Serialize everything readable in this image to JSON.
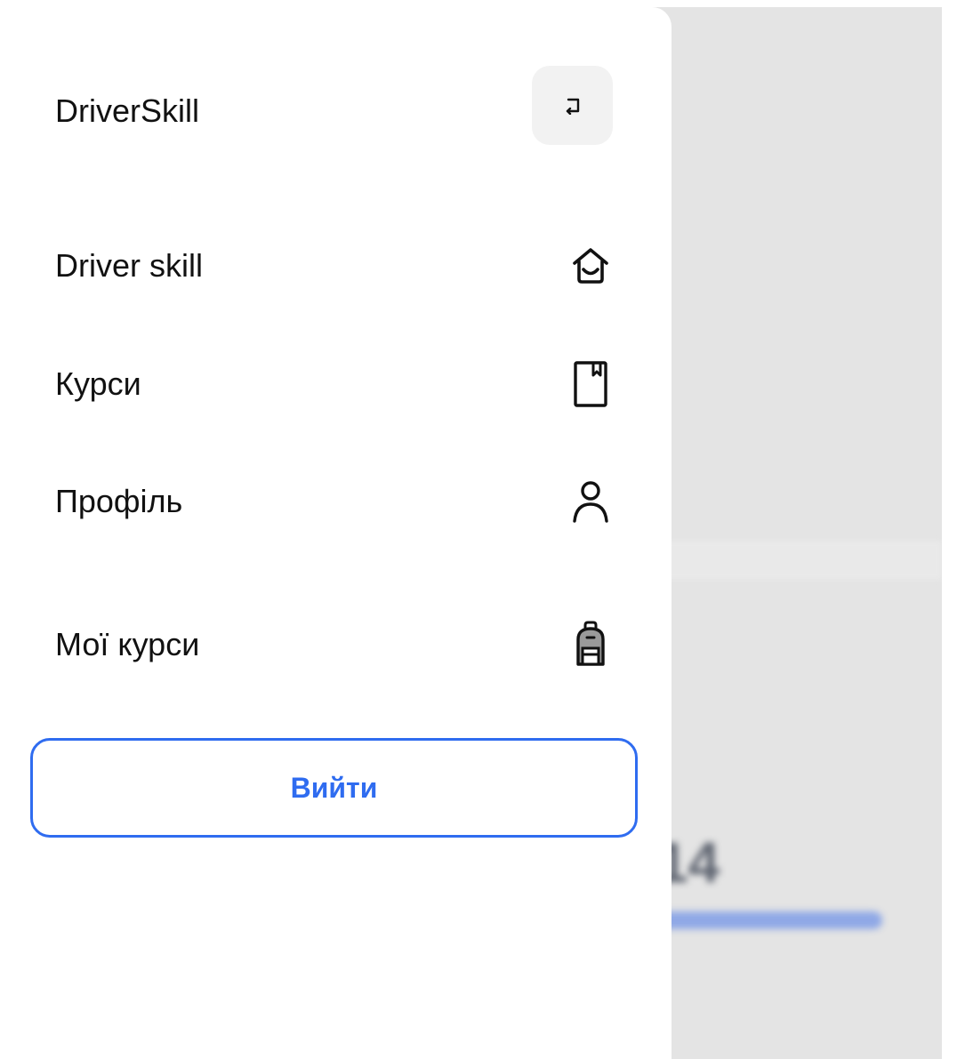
{
  "drawer": {
    "app_title": "DriverSkill",
    "back_icon": "back-arrow-icon",
    "items": [
      {
        "label": "Driver skill",
        "icon": "home-icon"
      },
      {
        "label": "Курси",
        "icon": "book-icon"
      },
      {
        "label": "Профіль",
        "icon": "user-icon"
      },
      {
        "label": "Мої курси",
        "icon": "backpack-icon"
      }
    ],
    "logout_label": "Вийти"
  },
  "backdrop": {
    "small_label": "",
    "big_number": "14",
    "progress": 0.8
  },
  "colors": {
    "accent": "#2f6cf0",
    "backdrop": "#e4e4e4",
    "text": "#111111"
  }
}
